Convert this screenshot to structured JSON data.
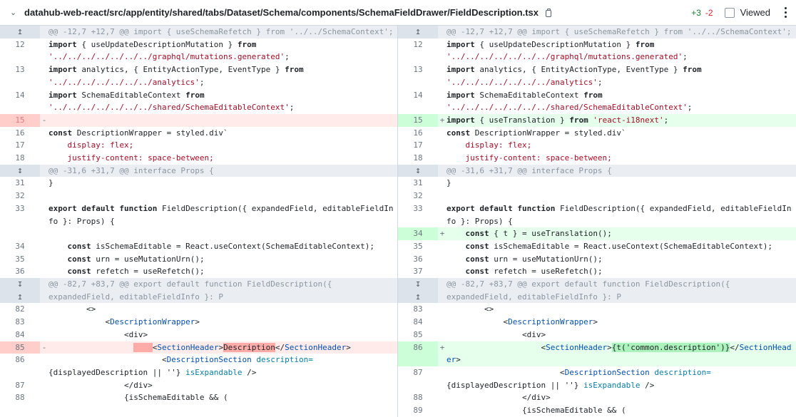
{
  "header": {
    "file_path": "datahub-web-react/src/app/entity/shared/tabs/Dataset/Schema/components/SchemaFieldDrawer/FieldDescription.tsx",
    "additions": "+3",
    "deletions": "-2",
    "viewed_label": "Viewed"
  },
  "hunks": {
    "h1": "@@ -12,7 +12,7 @@ import { useSchemaRefetch } from '../../SchemaContext';",
    "h2": "@@ -31,6 +31,7 @@ interface Props {",
    "h3a": "@@ -82,7 +83,7 @@ export default function FieldDescription({",
    "h3b": "expandedField, editableFieldInfo }: P"
  },
  "left_nums": [
    "12",
    "13",
    "14",
    "15",
    "16",
    "17",
    "18",
    "31",
    "32",
    "33",
    "34",
    "35",
    "36",
    "82",
    "83",
    "84",
    "85",
    "86",
    "87",
    "88"
  ],
  "right_nums": [
    "12",
    "13",
    "14",
    "15",
    "16",
    "17",
    "18",
    "31",
    "32",
    "33",
    "34",
    "35",
    "36",
    "37",
    "83",
    "84",
    "85",
    "86",
    "87",
    "88",
    "89"
  ],
  "code": {
    "import1_kw": "import",
    "import1_rest": " { useUpdateDescriptionMutation } ",
    "from": "from",
    "import1_path": "'../../../../../../../graphql/mutations.generated'",
    "import2_rest": " analytics, { EntityActionType, EventType } ",
    "import2_path": "'../../../../../../../analytics'",
    "import3_rest": " SchemaEditableContext ",
    "import3_path": "'../../../../../../../shared/SchemaEditableContext'",
    "import_i18n_rest": " { useTranslation } ",
    "import_i18n_path": "'react-i18next'",
    "semi": ";",
    "const": "const",
    "wrapper_rest": " DescriptionWrapper = styled.div`",
    "css1": "    display: flex;",
    "css2": "    justify-content: space-between;",
    "close_brace": "}",
    "export_kw": "export default function",
    "export_rest": " FieldDescription({ expandedField, editableFieldInfo }: Props) {",
    "t_hook": " { t } = useTranslation();",
    "schema_editable": " isSchemaEditable = React.useContext(SchemaEditableContext);",
    "urn": " urn = useMutationUrn();",
    "refetch": " refetch = useRefetch();",
    "frag_open": "        <>",
    "dw_open_lt": "            <",
    "dw_name": "DescriptionWrapper",
    "gt": ">",
    "div_open": "                <div>",
    "sh_indent": "                    <",
    "sh_name": "SectionHeader",
    "sh_old_text": "Description",
    "sh_close_lt": "</",
    "sh_new_text": "{t('common.description')}",
    "ds_indent": "                        <",
    "ds_name": "DescriptionSection",
    "ds_attr": " description=",
    "ds_value": "{displayedDescription || ''}",
    "ds_expandable": " isExpandable",
    "ds_end": " />",
    "div_close": "                </div>",
    "edit_line": "                {isSchemaEditable && ("
  }
}
